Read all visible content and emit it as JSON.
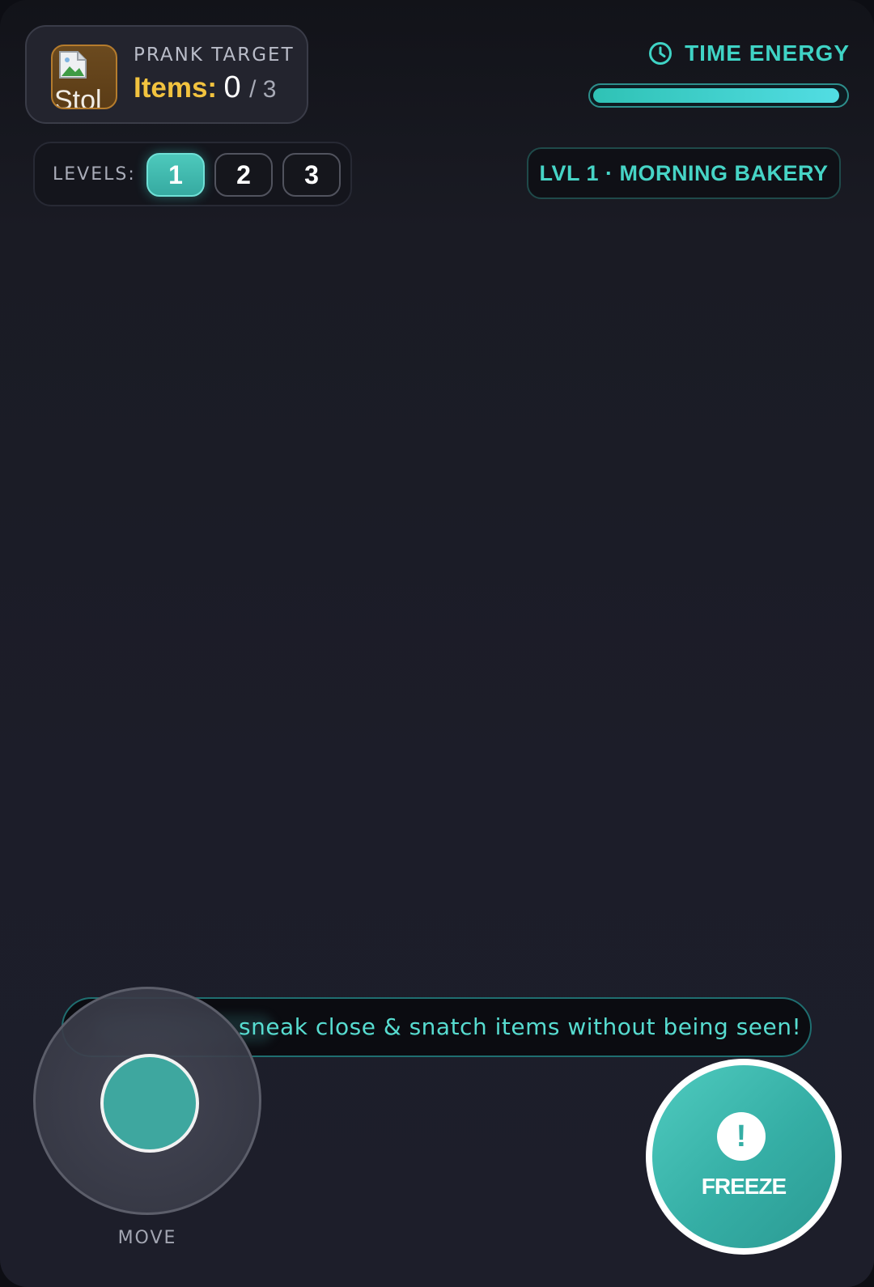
{
  "target": {
    "title": "PRANK TARGET",
    "thumb_alt": "Stol",
    "items_label": "Items:",
    "items_count": "0",
    "items_total": "/ 3"
  },
  "energy": {
    "label": "TIME ENERGY",
    "icon": "clock-icon",
    "level_fraction": 0.98
  },
  "levels": {
    "label": "LEVELS:",
    "buttons": [
      "1",
      "2",
      "3"
    ],
    "active": "1"
  },
  "level_name": "LVL 1 · MORNING BAKERY",
  "hint": {
    "text": "sneak close & snatch items without being seen!"
  },
  "controls": {
    "move_label": "MOVE",
    "freeze_label": "FREEZE",
    "freeze_icon": "exclamation-icon"
  },
  "colors": {
    "accent": "#3fd3c5",
    "gold": "#f2c33f",
    "background": "#1c1d29"
  }
}
